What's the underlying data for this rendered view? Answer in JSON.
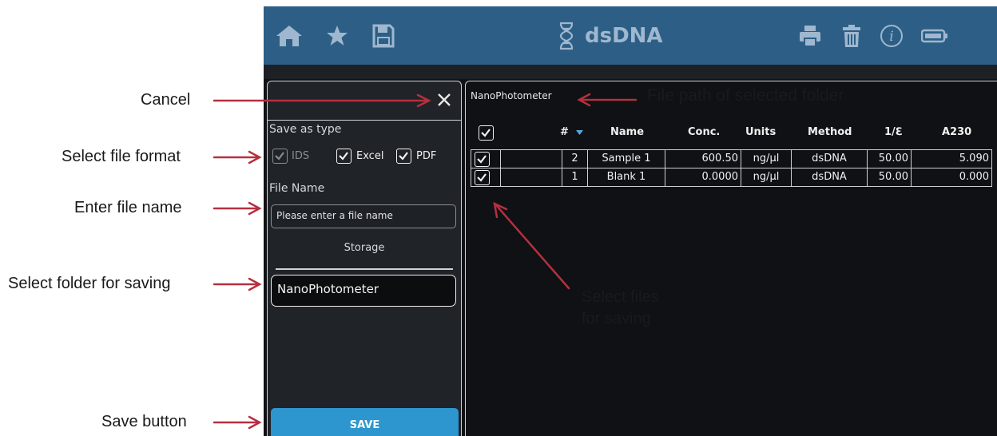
{
  "app": {
    "title": "dsDNA"
  },
  "topbar": {
    "left_icons": [
      "home-icon",
      "star-icon",
      "save-icon"
    ],
    "title_icon": "dna-icon",
    "right_icons": [
      "print-icon",
      "trash-icon",
      "info-icon",
      "battery-icon"
    ]
  },
  "side_panel": {
    "save_as_type_label": "Save as type",
    "formats": [
      {
        "label": "IDS",
        "checked": true,
        "disabled": true
      },
      {
        "label": "Excel",
        "checked": true,
        "disabled": false
      },
      {
        "label": "PDF",
        "checked": true,
        "disabled": false
      }
    ],
    "file_name_label": "File Name",
    "file_name_placeholder": "Please enter a file name",
    "storage_label": "Storage",
    "folder": "NanoPhotometer",
    "save_label": "SAVE"
  },
  "main_panel": {
    "path": "NanoPhotometer",
    "headers": [
      "#",
      "Name",
      "Conc.",
      "Units",
      "Method",
      "1/ℇ",
      "A230"
    ],
    "rows": [
      {
        "checked": true,
        "num": "2",
        "name": "Sample 1",
        "conc": "600.50",
        "units": "ng/µl",
        "method": "dsDNA",
        "inv_e": "50.00",
        "a230": "5.090"
      },
      {
        "checked": true,
        "num": "1",
        "name": "Blank 1",
        "conc": "0.0000",
        "units": "ng/µl",
        "method": "dsDNA",
        "inv_e": "50.00",
        "a230": "0.000"
      }
    ]
  },
  "annotations": {
    "cancel": "Cancel",
    "select_format": "Select file format",
    "enter_name": "Enter file name",
    "select_folder": "Select folder for saving",
    "save_button": "Save button",
    "file_path": "File path of selected folder",
    "select_files_1": "Select files",
    "select_files_2": "for saving"
  },
  "colors": {
    "topbar": "#2d5f86",
    "accent": "#2e96cf",
    "arrow": "#b5303f",
    "panel": "#202327",
    "background": "#0f1114"
  }
}
